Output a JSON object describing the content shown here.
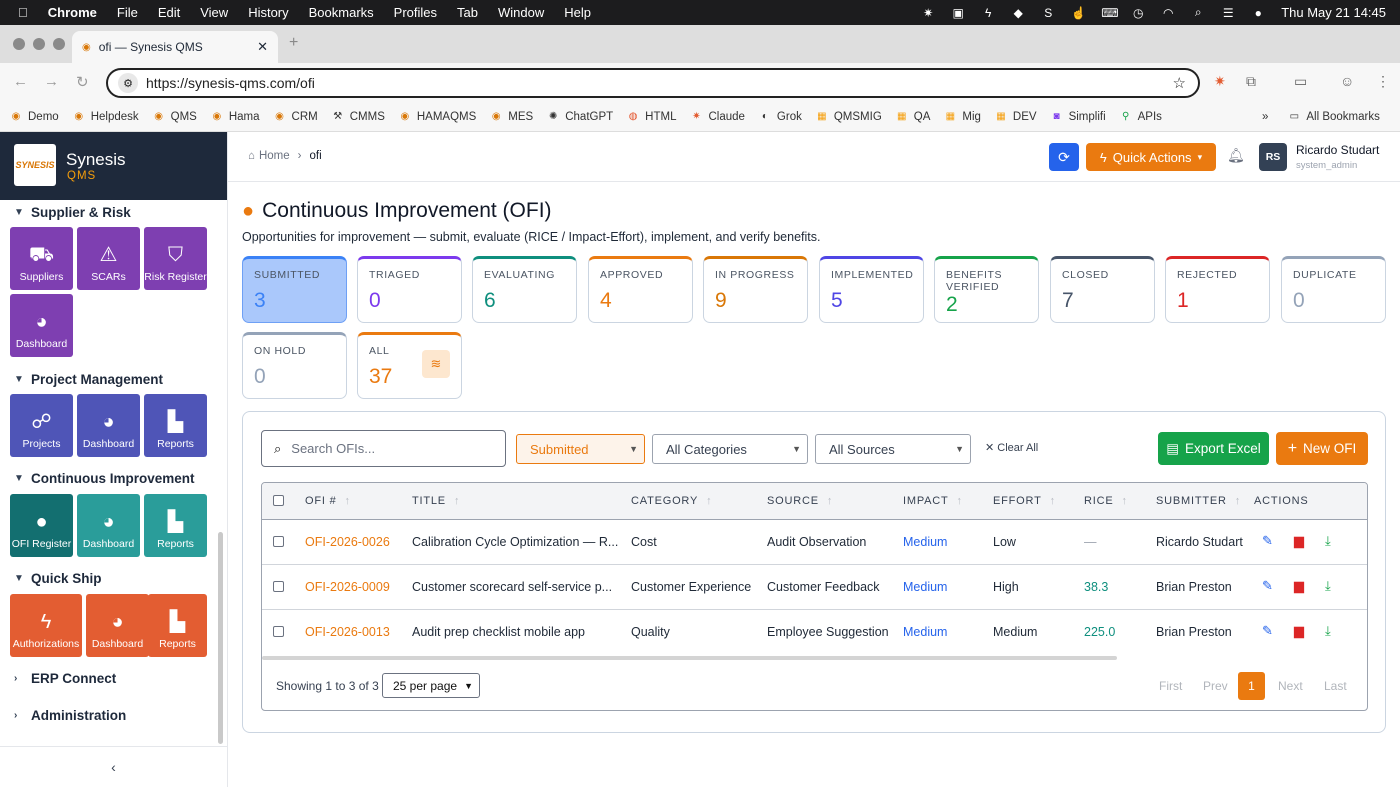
{
  "macbar": {
    "apple": "",
    "menus": [
      "Chrome",
      "File",
      "Edit",
      "View",
      "History",
      "Bookmarks",
      "Profiles",
      "Tab",
      "Window",
      "Help"
    ],
    "clock": "Thu May 21  14:45"
  },
  "browser": {
    "tab_title": "ofi — Synesis QMS",
    "url": "https://synesis-qms.com/ofi",
    "bookmarks": [
      "Demo",
      "Helpdesk",
      "QMS",
      "Hama",
      "CRM",
      "CMMS",
      "HAMAQMS",
      "MES",
      "ChatGPT",
      "HTML",
      "Claude",
      "Grok",
      "QMSMIG",
      "QA",
      "Mig",
      "DEV",
      "Simplifi",
      "APIs"
    ],
    "all_bookmarks": "All Bookmarks"
  },
  "sidebar": {
    "brand": "Synesis",
    "brand_sub": "QMS",
    "logo_text": "SYNESIS",
    "sections": {
      "supplier": {
        "title": "Supplier & Risk",
        "tiles": [
          "Suppliers",
          "SCARs",
          "Risk Register",
          "Dashboard"
        ]
      },
      "project": {
        "title": "Project Management",
        "tiles": [
          "Projects",
          "Dashboard",
          "Reports"
        ]
      },
      "ci": {
        "title": "Continuous Improvement",
        "tiles": [
          "OFI Register",
          "Dashboard",
          "Reports"
        ]
      },
      "quickship": {
        "title": "Quick Ship",
        "tiles": [
          "Authorizations",
          "Dashboard",
          "Reports"
        ]
      },
      "erp": {
        "title": "ERP Connect"
      },
      "admin": {
        "title": "Administration"
      }
    }
  },
  "topbar": {
    "home": "Home",
    "current": "ofi",
    "quick_actions": "Quick Actions",
    "avatar": "RS",
    "user_name": "Ricardo Studart",
    "user_role": "system_admin"
  },
  "page": {
    "title": "Continuous Improvement (OFI)",
    "description": "Opportunities for improvement — submit, evaluate (RICE / Impact-Effort), implement, and verify benefits."
  },
  "status_cards": [
    {
      "label": "SUBMITTED",
      "count": "3",
      "color": "#3b82f6"
    },
    {
      "label": "TRIAGED",
      "count": "0",
      "color": "#7c3aed"
    },
    {
      "label": "EVALUATING",
      "count": "6",
      "color": "#0f8f7e"
    },
    {
      "label": "APPROVED",
      "count": "4",
      "color": "#ea7a10"
    },
    {
      "label": "IN PROGRESS",
      "count": "9",
      "color": "#d97706"
    },
    {
      "label": "IMPLEMENTED",
      "count": "5",
      "color": "#4f46e5"
    },
    {
      "label": "BENEFITS VERIFIED",
      "count": "2",
      "color": "#16a34a"
    },
    {
      "label": "CLOSED",
      "count": "7",
      "color": "#475569"
    },
    {
      "label": "REJECTED",
      "count": "1",
      "color": "#dc2626"
    },
    {
      "label": "DUPLICATE",
      "count": "0",
      "color": "#94a3b8"
    },
    {
      "label": "ON HOLD",
      "count": "0",
      "color": "#94a3b8"
    },
    {
      "label": "ALL",
      "count": "37",
      "color": "#ea7a10"
    }
  ],
  "filters": {
    "search_placeholder": "Search OFIs...",
    "status": "Submitted",
    "category": "All Categories",
    "source": "All Sources",
    "clear": "Clear All",
    "export": "Export Excel",
    "new": "New OFI"
  },
  "table": {
    "columns": [
      "OFI #",
      "TITLE",
      "CATEGORY",
      "SOURCE",
      "IMPACT",
      "EFFORT",
      "RICE",
      "SUBMITTER",
      "ACTIONS"
    ],
    "rows": [
      {
        "id": "OFI-2026-0026",
        "title": "Calibration Cycle Optimization — R...",
        "category": "Cost",
        "source": "Audit Observation",
        "impact": "Medium",
        "effort": "Low",
        "rice": "—",
        "submitter": "Ricardo Studart"
      },
      {
        "id": "OFI-2026-0009",
        "title": "Customer scorecard self-service p...",
        "category": "Customer Experience",
        "source": "Customer Feedback",
        "impact": "Medium",
        "effort": "High",
        "rice": "38.3",
        "submitter": "Brian Preston"
      },
      {
        "id": "OFI-2026-0013",
        "title": "Audit prep checklist mobile app",
        "category": "Quality",
        "source": "Employee Suggestion",
        "impact": "Medium",
        "effort": "Medium",
        "rice": "225.0",
        "submitter": "Brian Preston"
      }
    ],
    "showing": "Showing 1 to 3 of 3",
    "per_page": "25 per page",
    "pager": {
      "first": "First",
      "prev": "Prev",
      "current": "1",
      "next": "Next",
      "last": "Last"
    }
  }
}
